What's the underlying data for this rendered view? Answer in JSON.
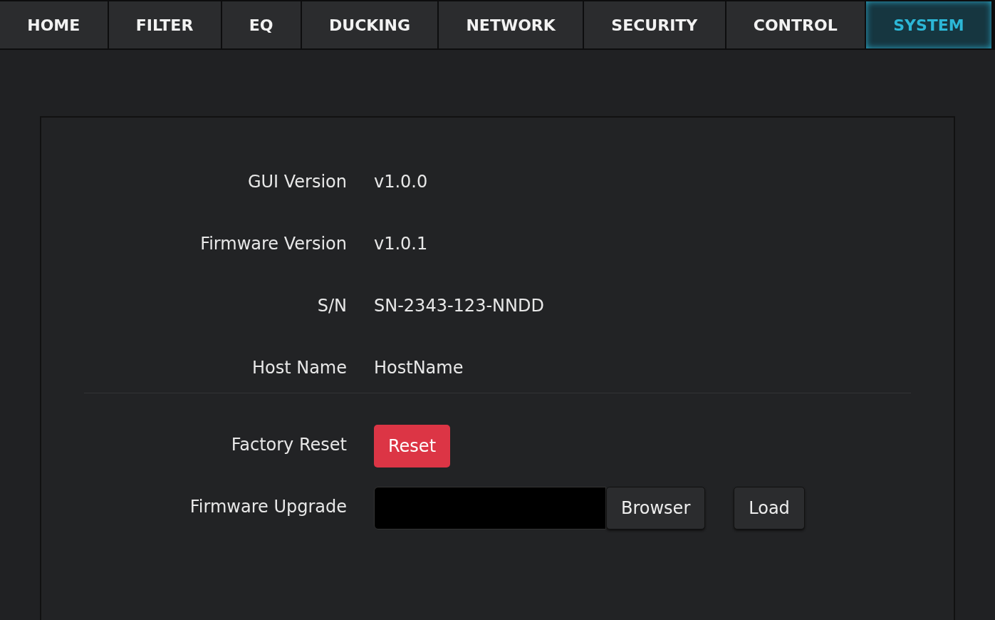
{
  "tabs": [
    {
      "label": "HOME",
      "selected": false
    },
    {
      "label": "FILTER",
      "selected": false
    },
    {
      "label": "EQ",
      "selected": false
    },
    {
      "label": "DUCKING",
      "selected": false
    },
    {
      "label": "NETWORK",
      "selected": false
    },
    {
      "label": "SECURITY",
      "selected": false
    },
    {
      "label": "CONTROL",
      "selected": false
    },
    {
      "label": "SYSTEM",
      "selected": true
    }
  ],
  "info": [
    {
      "label": "GUI Version",
      "value": "v1.0.0"
    },
    {
      "label": "Firmware Version",
      "value": "v1.0.1"
    },
    {
      "label": "S/N",
      "value": "SN-2343-123-NNDD"
    },
    {
      "label": "Host Name",
      "value": "HostName"
    }
  ],
  "factory_reset": {
    "label": "Factory Reset",
    "button": "Reset"
  },
  "firmware_upgrade": {
    "label": "Firmware Upgrade",
    "browse_button": "Browser",
    "load_button": "Load"
  }
}
